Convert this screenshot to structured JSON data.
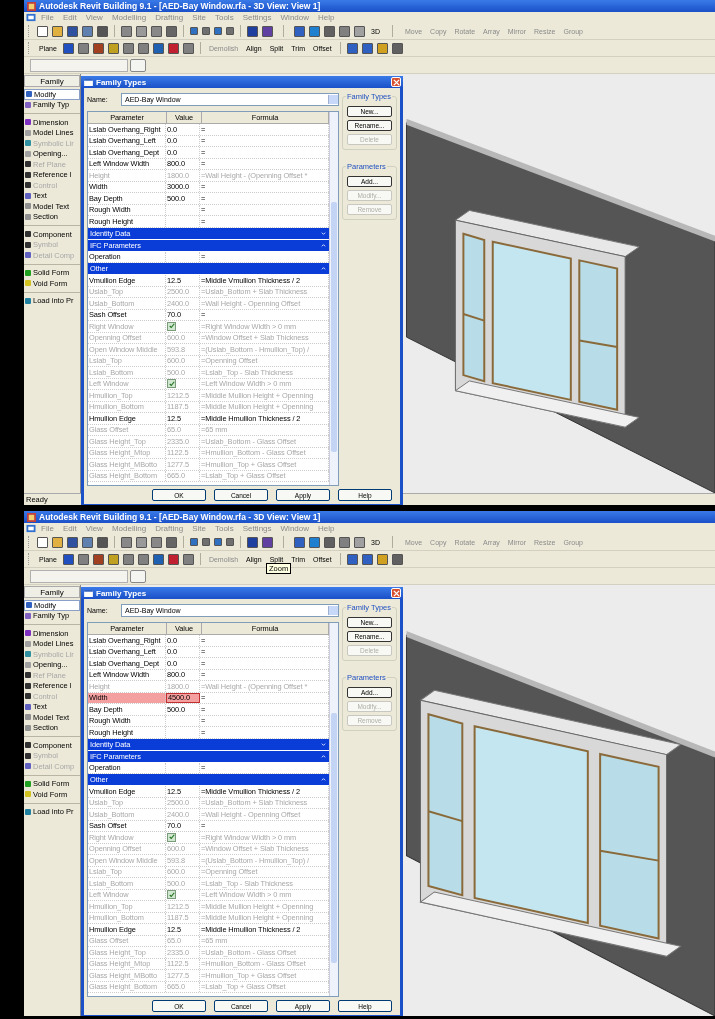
{
  "screens": [
    {
      "title": "Autodesk Revit Building 9.1 - [AED-Bay Window.rfa - 3D View: View 1]",
      "menu": [
        "File",
        "Edit",
        "View",
        "Modelling",
        "Drafting",
        "Site",
        "Tools",
        "Settings",
        "Window",
        "Help"
      ],
      "toolbar_1": {
        "view_3d": "3D",
        "tools": [
          "Move",
          "Copy",
          "Rotate",
          "Array",
          "Mirror",
          "Resize",
          "Group"
        ]
      },
      "toolbar_2": {
        "tools": [
          {
            "label": "Plane",
            "disabled": false
          },
          {
            "label": "Demolish",
            "disabled": true
          },
          {
            "label": "Align",
            "disabled": false
          },
          {
            "label": "Split",
            "disabled": false
          },
          {
            "label": "Trim",
            "disabled": false
          },
          {
            "label": "Offset",
            "disabled": false
          }
        ]
      },
      "palette": {
        "header": "Family",
        "groups": [
          [
            {
              "label": "Modify",
              "selected": true,
              "disabled": false
            },
            {
              "label": "Family Typ",
              "selected": false,
              "disabled": false
            }
          ],
          [
            {
              "label": "Dimension",
              "selected": false,
              "disabled": false
            },
            {
              "label": "Model Lines",
              "selected": false,
              "disabled": false
            },
            {
              "label": "Symbolic Lir",
              "selected": false,
              "disabled": true
            },
            {
              "label": "Opening...",
              "selected": false,
              "disabled": false
            },
            {
              "label": "Ref Plane",
              "selected": false,
              "disabled": true
            },
            {
              "label": "Reference l",
              "selected": false,
              "disabled": false
            },
            {
              "label": "Control",
              "selected": false,
              "disabled": true
            },
            {
              "label": "Text",
              "selected": false,
              "disabled": false
            },
            {
              "label": "Model Text",
              "selected": false,
              "disabled": false
            },
            {
              "label": "Section",
              "selected": false,
              "disabled": false
            }
          ],
          [
            {
              "label": "Component",
              "selected": false,
              "disabled": false
            },
            {
              "label": "Symbol",
              "selected": false,
              "disabled": true
            },
            {
              "label": "Detail Comp",
              "selected": false,
              "disabled": true
            }
          ],
          [
            {
              "label": "Solid Form",
              "selected": false,
              "disabled": false
            },
            {
              "label": "Void Form",
              "selected": false,
              "disabled": false
            }
          ],
          [
            {
              "label": "Load into Pr",
              "selected": false,
              "disabled": false
            }
          ]
        ]
      },
      "dialog": {
        "title": "Family Types",
        "name_label": "Name:",
        "name_value": "AED-Bay Window",
        "columns": [
          "Parameter",
          "Value",
          "Formula"
        ],
        "rows": [
          {
            "kind": "param",
            "parameter": "Lslab Overhang_Right",
            "value": "0.0",
            "formula": "=",
            "disabled": false,
            "editing": false
          },
          {
            "kind": "param",
            "parameter": "Lslab Overhang_Left",
            "value": "0.0",
            "formula": "=",
            "disabled": false,
            "editing": false
          },
          {
            "kind": "param",
            "parameter": "Lslab Overhang_Dept",
            "value": "0.0",
            "formula": "=",
            "disabled": false,
            "editing": false
          },
          {
            "kind": "param",
            "parameter": "Left Window Width",
            "value": "800.0",
            "formula": "=",
            "disabled": false,
            "editing": false
          },
          {
            "kind": "param",
            "parameter": "Height",
            "value": "1800.0",
            "formula": "=Wall Height - (Openning Offset *",
            "disabled": true,
            "editing": false
          },
          {
            "kind": "param",
            "parameter": "Width",
            "value": "3000.0",
            "formula": "=",
            "disabled": false,
            "editing": false
          },
          {
            "kind": "param",
            "parameter": "Bay Depth",
            "value": "500.0",
            "formula": "=",
            "disabled": false,
            "editing": false
          },
          {
            "kind": "param",
            "parameter": "Rough Width",
            "value": "",
            "formula": "=",
            "disabled": false,
            "editing": false
          },
          {
            "kind": "param",
            "parameter": "Rough Height",
            "value": "",
            "formula": "=",
            "disabled": false,
            "editing": false
          },
          {
            "kind": "group",
            "label": "Identity Data",
            "expanded": false
          },
          {
            "kind": "group",
            "label": "IFC Parameters",
            "expanded": true
          },
          {
            "kind": "param",
            "parameter": "Operation",
            "value": "",
            "formula": "=",
            "disabled": false,
            "editing": false
          },
          {
            "kind": "group",
            "label": "Other",
            "expanded": true
          },
          {
            "kind": "param",
            "parameter": "Vmullion Edge",
            "value": "12.5",
            "formula": "=Middle Vmullion Thickness / 2",
            "disabled": false,
            "editing": false
          },
          {
            "kind": "param",
            "parameter": "Uslab_Top",
            "value": "2500.0",
            "formula": "=Uslab_Bottom + Slab Thickness",
            "disabled": true,
            "editing": false
          },
          {
            "kind": "param",
            "parameter": "Uslab_Bottom",
            "value": "2400.0",
            "formula": "=Wall Height - Openning Offset",
            "disabled": true,
            "editing": false
          },
          {
            "kind": "param",
            "parameter": "Sash Offset",
            "value": "70.0",
            "formula": "=",
            "disabled": false,
            "editing": false
          },
          {
            "kind": "check",
            "parameter": "Right Window",
            "checked": true,
            "formula": "=Right Window Width > 0 mm",
            "disabled": true
          },
          {
            "kind": "param",
            "parameter": "Openning Offset",
            "value": "600.0",
            "formula": "=Window Offset + Slab Thickness",
            "disabled": true,
            "editing": false
          },
          {
            "kind": "param",
            "parameter": "Open Window Middle",
            "value": "593.8",
            "formula": "=(Uslab_Bottom - Hmullion_Top) /",
            "disabled": true,
            "editing": false
          },
          {
            "kind": "param",
            "parameter": "Lslab_Top",
            "value": "600.0",
            "formula": "=Openning Offset",
            "disabled": true,
            "editing": false
          },
          {
            "kind": "param",
            "parameter": "Lslab_Bottom",
            "value": "500.0",
            "formula": "=Lslab_Top - Slab Thickness",
            "disabled": true,
            "editing": false
          },
          {
            "kind": "check",
            "parameter": "Left Window",
            "checked": true,
            "formula": "=Left Window Width > 0 mm",
            "disabled": true
          },
          {
            "kind": "param",
            "parameter": "Hmullion_Top",
            "value": "1212.5",
            "formula": "=Middle Mullion Height + Openning",
            "disabled": true,
            "editing": false
          },
          {
            "kind": "param",
            "parameter": "Hmullion_Bottom",
            "value": "1187.5",
            "formula": "=Middle Mullion Height + Openning",
            "disabled": true,
            "editing": false
          },
          {
            "kind": "param",
            "parameter": "Hmullion Edge",
            "value": "12.5",
            "formula": "=Middle Hmullion Thickness / 2",
            "disabled": false,
            "editing": false
          },
          {
            "kind": "param",
            "parameter": "Glass Offset",
            "value": "65.0",
            "formula": "=65 mm",
            "disabled": true,
            "editing": false
          },
          {
            "kind": "param",
            "parameter": "Glass Height_Top",
            "value": "2335.0",
            "formula": "=Uslab_Bottom - Glass Offset",
            "disabled": true,
            "editing": false
          },
          {
            "kind": "param",
            "parameter": "Glass Height_Mtop",
            "value": "1122.5",
            "formula": "=Hmullion_Bottom - Glass Offset",
            "disabled": true,
            "editing": false
          },
          {
            "kind": "param",
            "parameter": "Glass Height_MBotto",
            "value": "1277.5",
            "formula": "=Hmullion_Top + Glass Offset",
            "disabled": true,
            "editing": false
          },
          {
            "kind": "param",
            "parameter": "Glass Height_Bottom",
            "value": "665.0",
            "formula": "=Lslab_Top + Glass Offset",
            "disabled": true,
            "editing": false
          }
        ],
        "family_types": {
          "title": "Family Types",
          "buttons": [
            {
              "label": "New...",
              "disabled": false
            },
            {
              "label": "Rename...",
              "disabled": false
            },
            {
              "label": "Delete",
              "disabled": true
            }
          ]
        },
        "parameters": {
          "title": "Parameters",
          "buttons": [
            {
              "label": "Add...",
              "disabled": false
            },
            {
              "label": "Modify...",
              "disabled": true
            },
            {
              "label": "Remove",
              "disabled": true
            }
          ]
        },
        "buttons": [
          "OK",
          "Cancel",
          "Apply",
          "Help"
        ]
      },
      "status": "Ready"
    },
    {
      "title": "Autodesk Revit Building 9.1 - [AED-Bay Window.rfa - 3D View: View 1]",
      "menu": [
        "File",
        "Edit",
        "View",
        "Modelling",
        "Drafting",
        "Site",
        "Tools",
        "Settings",
        "Window",
        "Help"
      ],
      "toolbar_1": {
        "view_3d": "3D",
        "tools": [
          "Move",
          "Copy",
          "Rotate",
          "Array",
          "Mirror",
          "Resize",
          "Group"
        ]
      },
      "toolbar_2": {
        "tools": [
          {
            "label": "Plane",
            "disabled": false
          },
          {
            "label": "Demolish",
            "disabled": true
          },
          {
            "label": "Align",
            "disabled": false
          },
          {
            "label": "Split",
            "disabled": false
          },
          {
            "label": "Trim",
            "disabled": false
          },
          {
            "label": "Offset",
            "disabled": false
          }
        ]
      },
      "tooltip": "Zoom",
      "palette": {
        "header": "Family",
        "groups": [
          [
            {
              "label": "Modify",
              "selected": true,
              "disabled": false
            },
            {
              "label": "Family Typ",
              "selected": false,
              "disabled": false
            }
          ],
          [
            {
              "label": "Dimension",
              "selected": false,
              "disabled": false
            },
            {
              "label": "Model Lines",
              "selected": false,
              "disabled": false
            },
            {
              "label": "Symbolic Lir",
              "selected": false,
              "disabled": true
            },
            {
              "label": "Opening...",
              "selected": false,
              "disabled": false
            },
            {
              "label": "Ref Plane",
              "selected": false,
              "disabled": true
            },
            {
              "label": "Reference l",
              "selected": false,
              "disabled": false
            },
            {
              "label": "Control",
              "selected": false,
              "disabled": true
            },
            {
              "label": "Text",
              "selected": false,
              "disabled": false
            },
            {
              "label": "Model Text",
              "selected": false,
              "disabled": false
            },
            {
              "label": "Section",
              "selected": false,
              "disabled": false
            }
          ],
          [
            {
              "label": "Component",
              "selected": false,
              "disabled": false
            },
            {
              "label": "Symbol",
              "selected": false,
              "disabled": true
            },
            {
              "label": "Detail Comp",
              "selected": false,
              "disabled": true
            }
          ],
          [
            {
              "label": "Solid Form",
              "selected": false,
              "disabled": false
            },
            {
              "label": "Void Form",
              "selected": false,
              "disabled": false
            }
          ],
          [
            {
              "label": "Load into Pr",
              "selected": false,
              "disabled": false
            }
          ]
        ]
      },
      "dialog": {
        "title": "Family Types",
        "name_label": "Name:",
        "name_value": "AED-Bay Window",
        "columns": [
          "Parameter",
          "Value",
          "Formula"
        ],
        "rows": [
          {
            "kind": "param",
            "parameter": "Lslab Overhang_Right",
            "value": "0.0",
            "formula": "=",
            "disabled": false,
            "editing": false
          },
          {
            "kind": "param",
            "parameter": "Lslab Overhang_Left",
            "value": "0.0",
            "formula": "=",
            "disabled": false,
            "editing": false
          },
          {
            "kind": "param",
            "parameter": "Lslab Overhang_Dept",
            "value": "0.0",
            "formula": "=",
            "disabled": false,
            "editing": false
          },
          {
            "kind": "param",
            "parameter": "Left Window Width",
            "value": "800.0",
            "formula": "=",
            "disabled": false,
            "editing": false
          },
          {
            "kind": "param",
            "parameter": "Height",
            "value": "1800.0",
            "formula": "=Wall Height - (Openning Offset *",
            "disabled": true,
            "editing": false
          },
          {
            "kind": "param",
            "parameter": "Width",
            "value": "4500.0",
            "formula": "=",
            "disabled": false,
            "editing": true
          },
          {
            "kind": "param",
            "parameter": "Bay Depth",
            "value": "500.0",
            "formula": "=",
            "disabled": false,
            "editing": false
          },
          {
            "kind": "param",
            "parameter": "Rough Width",
            "value": "",
            "formula": "=",
            "disabled": false,
            "editing": false
          },
          {
            "kind": "param",
            "parameter": "Rough Height",
            "value": "",
            "formula": "=",
            "disabled": false,
            "editing": false
          },
          {
            "kind": "group",
            "label": "Identity Data",
            "expanded": false
          },
          {
            "kind": "group",
            "label": "IFC Parameters",
            "expanded": true
          },
          {
            "kind": "param",
            "parameter": "Operation",
            "value": "",
            "formula": "=",
            "disabled": false,
            "editing": false
          },
          {
            "kind": "group",
            "label": "Other",
            "expanded": true
          },
          {
            "kind": "param",
            "parameter": "Vmullion Edge",
            "value": "12.5",
            "formula": "=Middle Vmullion Thickness / 2",
            "disabled": false,
            "editing": false
          },
          {
            "kind": "param",
            "parameter": "Uslab_Top",
            "value": "2500.0",
            "formula": "=Uslab_Bottom + Slab Thickness",
            "disabled": true,
            "editing": false
          },
          {
            "kind": "param",
            "parameter": "Uslab_Bottom",
            "value": "2400.0",
            "formula": "=Wall Height - Openning Offset",
            "disabled": true,
            "editing": false
          },
          {
            "kind": "param",
            "parameter": "Sash Offset",
            "value": "70.0",
            "formula": "=",
            "disabled": false,
            "editing": false
          },
          {
            "kind": "check",
            "parameter": "Right Window",
            "checked": true,
            "formula": "=Right Window Width > 0 mm",
            "disabled": true
          },
          {
            "kind": "param",
            "parameter": "Openning Offset",
            "value": "600.0",
            "formula": "=Window Offset + Slab Thickness",
            "disabled": true,
            "editing": false
          },
          {
            "kind": "param",
            "parameter": "Open Window Middle",
            "value": "593.8",
            "formula": "=(Uslab_Bottom - Hmullion_Top) /",
            "disabled": true,
            "editing": false
          },
          {
            "kind": "param",
            "parameter": "Lslab_Top",
            "value": "600.0",
            "formula": "=Openning Offset",
            "disabled": true,
            "editing": false
          },
          {
            "kind": "param",
            "parameter": "Lslab_Bottom",
            "value": "500.0",
            "formula": "=Lslab_Top - Slab Thickness",
            "disabled": true,
            "editing": false
          },
          {
            "kind": "check",
            "parameter": "Left Window",
            "checked": true,
            "formula": "=Left Window Width > 0 mm",
            "disabled": true
          },
          {
            "kind": "param",
            "parameter": "Hmullion_Top",
            "value": "1212.5",
            "formula": "=Middle Mullion Height + Openning",
            "disabled": true,
            "editing": false
          },
          {
            "kind": "param",
            "parameter": "Hmullion_Bottom",
            "value": "1187.5",
            "formula": "=Middle Mullion Height + Openning",
            "disabled": true,
            "editing": false
          },
          {
            "kind": "param",
            "parameter": "Hmullion Edge",
            "value": "12.5",
            "formula": "=Middle Hmullion Thickness / 2",
            "disabled": false,
            "editing": false
          },
          {
            "kind": "param",
            "parameter": "Glass Offset",
            "value": "65.0",
            "formula": "=65 mm",
            "disabled": true,
            "editing": false
          },
          {
            "kind": "param",
            "parameter": "Glass Height_Top",
            "value": "2335.0",
            "formula": "=Uslab_Bottom - Glass Offset",
            "disabled": true,
            "editing": false
          },
          {
            "kind": "param",
            "parameter": "Glass Height_Mtop",
            "value": "1122.5",
            "formula": "=Hmullion_Bottom - Glass Offset",
            "disabled": true,
            "editing": false
          },
          {
            "kind": "param",
            "parameter": "Glass Height_MBotto",
            "value": "1277.5",
            "formula": "=Hmullion_Top + Glass Offset",
            "disabled": true,
            "editing": false
          },
          {
            "kind": "param",
            "parameter": "Glass Height_Bottom",
            "value": "665.0",
            "formula": "=Lslab_Top + Glass Offset",
            "disabled": true,
            "editing": false
          }
        ],
        "family_types": {
          "title": "Family Types",
          "buttons": [
            {
              "label": "New...",
              "disabled": false
            },
            {
              "label": "Rename...",
              "disabled": false
            },
            {
              "label": "Delete",
              "disabled": true
            }
          ]
        },
        "parameters": {
          "title": "Parameters",
          "buttons": [
            {
              "label": "Add...",
              "disabled": false
            },
            {
              "label": "Modify...",
              "disabled": true
            },
            {
              "label": "Remove",
              "disabled": true
            }
          ]
        },
        "buttons": [
          "OK",
          "Cancel",
          "Apply",
          "Help"
        ]
      }
    }
  ]
}
